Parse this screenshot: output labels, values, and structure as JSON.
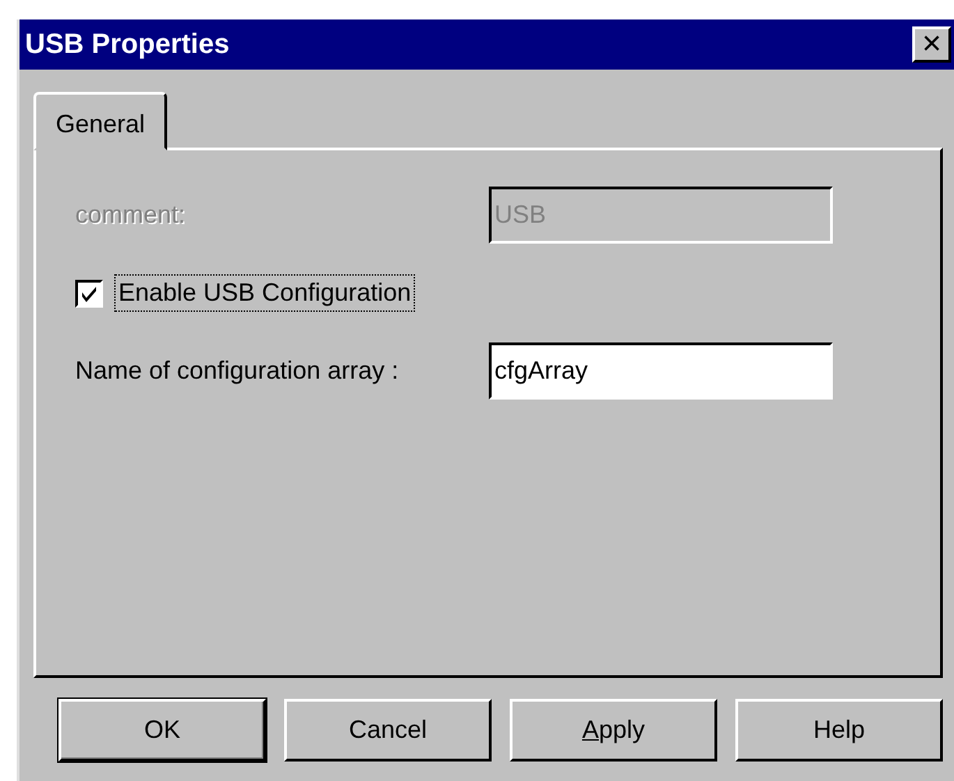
{
  "window": {
    "title": "USB Properties",
    "close_button": "×"
  },
  "tabs": [
    {
      "label": "General",
      "selected": true
    }
  ],
  "fields": [
    {
      "label": "comment:",
      "value": "USB",
      "disabled": true
    },
    {
      "label": "Name of configuration array :",
      "value": "cfgArray",
      "disabled": false
    }
  ],
  "checkbox": {
    "label": "Enable USB Configuration",
    "checked": true,
    "focused": true
  },
  "buttons": [
    {
      "label": "OK",
      "default": true,
      "mnemonic": false
    },
    {
      "label": "Cancel",
      "default": false,
      "mnemonic": false
    },
    {
      "label": "Apply",
      "default": false,
      "mnemonic": true
    },
    {
      "label": "Help",
      "default": false,
      "mnemonic": false
    }
  ]
}
